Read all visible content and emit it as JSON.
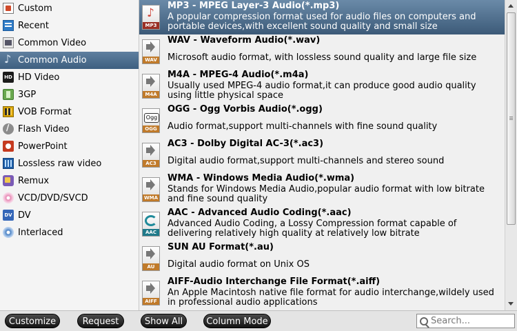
{
  "sidebar": {
    "items": [
      {
        "label": "Custom",
        "icon": "custom-icon"
      },
      {
        "label": "Recent",
        "icon": "recent-icon"
      },
      {
        "label": "Common Video",
        "icon": "common-video-icon"
      },
      {
        "label": "Common Audio",
        "icon": "common-audio-icon",
        "selected": true
      },
      {
        "label": "HD Video",
        "icon": "hd-video-icon"
      },
      {
        "label": "3GP",
        "icon": "3gp-icon"
      },
      {
        "label": "VOB Format",
        "icon": "vob-format-icon"
      },
      {
        "label": "Flash Video",
        "icon": "flash-video-icon"
      },
      {
        "label": "PowerPoint",
        "icon": "powerpoint-icon"
      },
      {
        "label": "Lossless raw video",
        "icon": "lossless-raw-video-icon"
      },
      {
        "label": "Remux",
        "icon": "remux-icon"
      },
      {
        "label": "VCD/DVD/SVCD",
        "icon": "vcd-dvd-svcd-icon"
      },
      {
        "label": "DV",
        "icon": "dv-icon"
      },
      {
        "label": "Interlaced",
        "icon": "interlaced-icon"
      }
    ],
    "hd_badge": "HD",
    "dv_badge": "DV"
  },
  "formats": [
    {
      "title": "MP3 - MPEG Layer-3 Audio(*.mp3)",
      "description": "A popular compression format used for audio files on computers and portable devices,with excellent sound quality and small size",
      "badge": "MP3",
      "selected": true
    },
    {
      "title": "WAV - Waveform Audio(*.wav)",
      "description": "Microsoft audio format, with lossless sound quality and large file size",
      "badge": "WAV"
    },
    {
      "title": "M4A - MPEG-4 Audio(*.m4a)",
      "description": "Usually used MPEG-4 audio format,it can produce good audio quality using little physical space",
      "badge": "M4A"
    },
    {
      "title": "OGG - Ogg Vorbis Audio(*.ogg)",
      "description": "Audio format,support multi-channels with fine sound quality",
      "badge": "OGG",
      "logo_text": "Ogg"
    },
    {
      "title": "AC3 - Dolby Digital AC-3(*.ac3)",
      "description": "Digital audio format,support multi-channels and stereo sound",
      "badge": "AC3"
    },
    {
      "title": "WMA - Windows Media Audio(*.wma)",
      "description": "Stands for Windows Media Audio,popular audio format with low bitrate and fine sound quality",
      "badge": "WMA"
    },
    {
      "title": "AAC - Advanced Audio Coding(*.aac)",
      "description": "Advanced Audio Coding, a Lossy Compression format capable of delivering relatively high quality at relatively low bitrate",
      "badge": "AAC"
    },
    {
      "title": "SUN AU Format(*.au)",
      "description": "Digital audio format on Unix OS",
      "badge": "AU"
    },
    {
      "title": "AIFF-Audio Interchange File Format(*.aiff)",
      "description": "An Apple Macintosh native file format for audio interchange,wildely used in professional audio applications",
      "badge": "AIFF"
    }
  ],
  "toolbar": {
    "customize_label": "Customize",
    "request_label": "Request",
    "show_all_label": "Show All",
    "column_mode_label": "Column Mode"
  },
  "search": {
    "placeholder": "Search...",
    "value": ""
  }
}
